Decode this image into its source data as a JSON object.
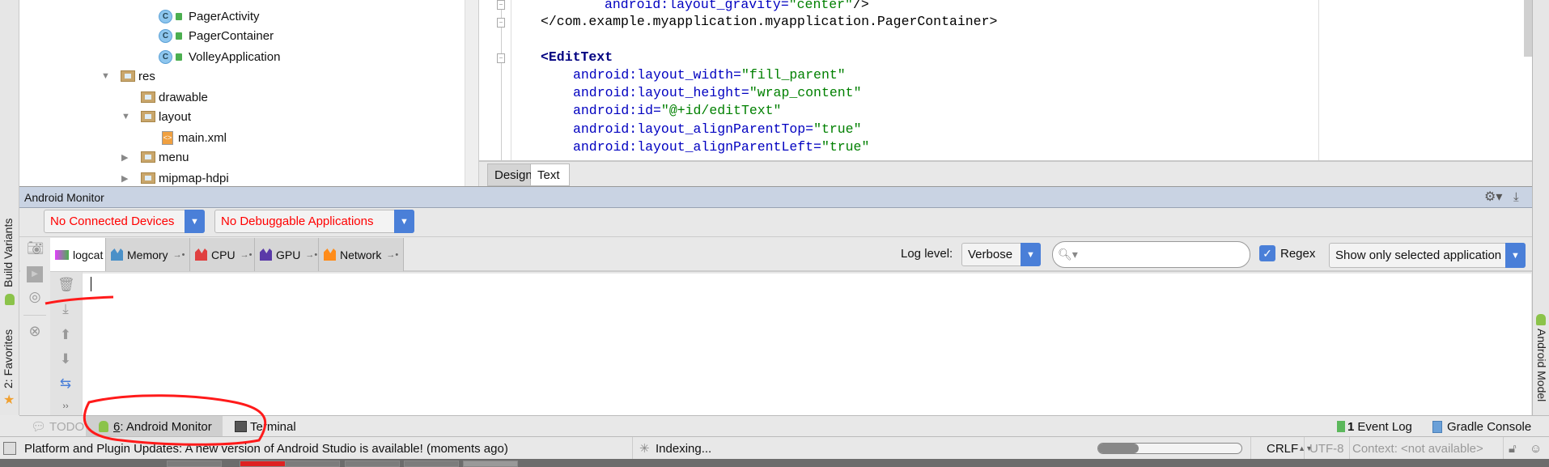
{
  "left_stripe": {
    "build_variants": "Build Variants",
    "favorites": "2: Favorites"
  },
  "right_stripe": {
    "android_model": "Android Model"
  },
  "project_tree": [
    {
      "label": "PagerActivity",
      "type": "class"
    },
    {
      "label": "PagerContainer",
      "type": "class"
    },
    {
      "label": "VolleyApplication",
      "type": "class"
    },
    {
      "label": "res",
      "type": "res-folder",
      "expanded": true
    },
    {
      "label": "drawable",
      "type": "folder"
    },
    {
      "label": "layout",
      "type": "folder",
      "expanded": true
    },
    {
      "label": "main.xml",
      "type": "xml-file"
    },
    {
      "label": "menu",
      "type": "folder",
      "expanded": false
    },
    {
      "label": "mipmap-hdpi",
      "type": "folder",
      "expanded": false
    }
  ],
  "editor": {
    "lines": {
      "l1_attr": "android:layout_gravity=",
      "l1_val": "\"center\"",
      "l1_end": "/>",
      "l2": "</com.example.myapplication.myapplication.PagerContainer>",
      "l4": "<EditText",
      "l5_attr": "android:layout_width=",
      "l5_val": "\"fill_parent\"",
      "l6_attr": "android:layout_height=",
      "l6_val": "\"wrap_content\"",
      "l7_attr": "android:id=",
      "l7_val": "\"@+id/editText\"",
      "l8_attr": "android:layout_alignParentTop=",
      "l8_val": "\"true\"",
      "l9_attr": "android:layout_alignParentLeft=",
      "l9_val": "\"true\""
    },
    "tabs": {
      "design": "Design",
      "text": "Text",
      "active": "Text"
    }
  },
  "monitor": {
    "title": "Android Monitor",
    "device_combo": "No Connected Devices",
    "app_combo": "No Debuggable Applications",
    "tabs": [
      {
        "label": "logcat",
        "color": "#e040fb",
        "active": true
      },
      {
        "label": "Memory",
        "color": "#4a90c8"
      },
      {
        "label": "CPU",
        "color": "#e04040"
      },
      {
        "label": "GPU",
        "color": "#5a3aa8"
      },
      {
        "label": "Network",
        "color": "#ff8c1a"
      }
    ],
    "log_level_label": "Log level:",
    "log_level_value": "Verbose",
    "search_value": "",
    "regex_label": "Regex",
    "regex_checked": true,
    "filter_combo": "Show only selected application"
  },
  "bottom_tabs": {
    "todo": "TODO",
    "android_monitor_num": "6",
    "android_monitor": ": Android Monitor",
    "terminal": "Terminal",
    "event_log_count": "1",
    "event_log": "Event Log",
    "gradle_console": "Gradle Console"
  },
  "status": {
    "message": "Platform and Plugin Updates: A new version of Android Studio is available! (moments ago)",
    "indexing": "Indexing...",
    "line_sep": "CRLF",
    "encoding": "UTF-8",
    "context": "Context: <not available>"
  },
  "colors": {
    "accent": "#4a7fd8",
    "error_text": "#ff0000",
    "annotation": "#ff0000"
  }
}
